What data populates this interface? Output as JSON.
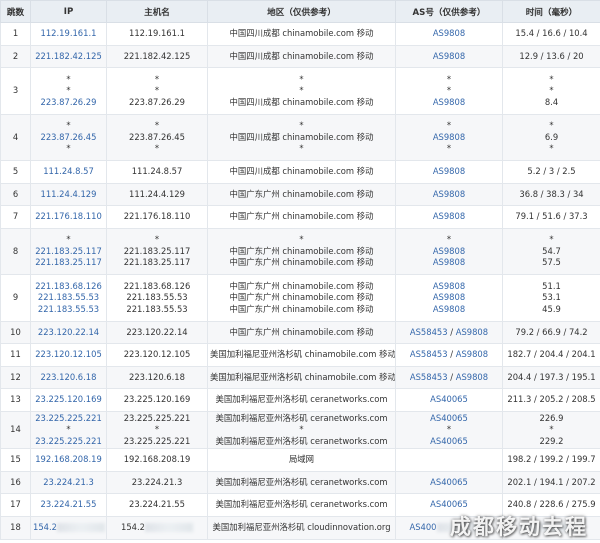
{
  "columns": [
    "跳数",
    "IP",
    "主机名",
    "地区（仅供参考）",
    "AS号（仅供参考）",
    "时间（毫秒）"
  ],
  "rows": [
    {
      "hop": "1",
      "lines": [
        {
          "ip": "112.19.161.1",
          "host": "112.19.161.1",
          "region": "中国四川成都 chinamobile.com 移动",
          "asn": [
            "AS9808"
          ],
          "time": "15.4 / 16.6 / 10.4"
        }
      ]
    },
    {
      "hop": "2",
      "lines": [
        {
          "ip": "221.182.42.125",
          "host": "221.182.42.125",
          "region": "中国四川成都 chinamobile.com 移动",
          "asn": [
            "AS9808"
          ],
          "time": "12.9 / 13.6 / 20"
        }
      ]
    },
    {
      "hop": "3",
      "lines": [
        {
          "ip": "*",
          "host": "*",
          "region": "*",
          "asn": [
            "*"
          ],
          "time": "*"
        },
        {
          "ip": "*",
          "host": "*",
          "region": "*",
          "asn": [
            "*"
          ],
          "time": "*"
        },
        {
          "ip": "223.87.26.29",
          "host": "223.87.26.29",
          "region": "中国四川成都 chinamobile.com 移动",
          "asn": [
            "AS9808"
          ],
          "time": "8.4"
        }
      ]
    },
    {
      "hop": "4",
      "lines": [
        {
          "ip": "*",
          "host": "*",
          "region": "*",
          "asn": [
            "*"
          ],
          "time": "*"
        },
        {
          "ip": "223.87.26.45",
          "host": "223.87.26.45",
          "region": "中国四川成都 chinamobile.com 移动",
          "asn": [
            "AS9808"
          ],
          "time": "6.9"
        },
        {
          "ip": "*",
          "host": "*",
          "region": "*",
          "asn": [
            "*"
          ],
          "time": "*"
        }
      ]
    },
    {
      "hop": "5",
      "lines": [
        {
          "ip": "111.24.8.57",
          "host": "111.24.8.57",
          "region": "中国四川成都 chinamobile.com 移动",
          "asn": [
            "AS9808"
          ],
          "time": "5.2 / 3 / 2.5"
        }
      ]
    },
    {
      "hop": "6",
      "lines": [
        {
          "ip": "111.24.4.129",
          "host": "111.24.4.129",
          "region": "中国广东广州 chinamobile.com 移动",
          "asn": [
            "AS9808"
          ],
          "time": "36.8 / 38.3 / 34"
        }
      ]
    },
    {
      "hop": "7",
      "lines": [
        {
          "ip": "221.176.18.110",
          "host": "221.176.18.110",
          "region": "中国广东广州 chinamobile.com 移动",
          "asn": [
            "AS9808"
          ],
          "time": "79.1 / 51.6 / 37.3"
        }
      ]
    },
    {
      "hop": "8",
      "lines": [
        {
          "ip": "*",
          "host": "*",
          "region": "*",
          "asn": [
            "*"
          ],
          "time": "*"
        },
        {
          "ip": "221.183.25.117",
          "host": "221.183.25.117",
          "region": "中国广东广州 chinamobile.com 移动",
          "asn": [
            "AS9808"
          ],
          "time": "54.7"
        },
        {
          "ip": "221.183.25.117",
          "host": "221.183.25.117",
          "region": "中国广东广州 chinamobile.com 移动",
          "asn": [
            "AS9808"
          ],
          "time": "57.5"
        }
      ]
    },
    {
      "hop": "9",
      "lines": [
        {
          "ip": "221.183.68.126",
          "host": "221.183.68.126",
          "region": "中国广东广州 chinamobile.com 移动",
          "asn": [
            "AS9808"
          ],
          "time": "51.1"
        },
        {
          "ip": "221.183.55.53",
          "host": "221.183.55.53",
          "region": "中国广东广州 chinamobile.com 移动",
          "asn": [
            "AS9808"
          ],
          "time": "53.1"
        },
        {
          "ip": "221.183.55.53",
          "host": "221.183.55.53",
          "region": "中国广东广州 chinamobile.com 移动",
          "asn": [
            "AS9808"
          ],
          "time": "45.9"
        }
      ]
    },
    {
      "hop": "10",
      "lines": [
        {
          "ip": "223.120.22.14",
          "host": "223.120.22.14",
          "region": "中国广东广州 chinamobile.com 移动",
          "asn": [
            "AS58453",
            "AS9808"
          ],
          "time": "79.2 / 66.9 / 74.2"
        }
      ]
    },
    {
      "hop": "11",
      "lines": [
        {
          "ip": "223.120.12.105",
          "host": "223.120.12.105",
          "region": "美国加利福尼亚州洛杉矶 chinamobile.com 移动",
          "asn": [
            "AS58453",
            "AS9808"
          ],
          "time": "182.7 / 204.4 / 204.1"
        }
      ]
    },
    {
      "hop": "12",
      "lines": [
        {
          "ip": "223.120.6.18",
          "host": "223.120.6.18",
          "region": "美国加利福尼亚州洛杉矶 chinamobile.com 移动",
          "asn": [
            "AS58453",
            "AS9808"
          ],
          "time": "204.4 / 197.3 / 195.1"
        }
      ]
    },
    {
      "hop": "13",
      "lines": [
        {
          "ip": "23.225.120.169",
          "host": "23.225.120.169",
          "region": "美国加利福尼亚州洛杉矶 ceranetworks.com",
          "asn": [
            "AS40065"
          ],
          "time": "211.3 / 205.2 / 208.5"
        }
      ]
    },
    {
      "hop": "14",
      "lines": [
        {
          "ip": "23.225.225.221",
          "host": "23.225.225.221",
          "region": "美国加利福尼亚州洛杉矶 ceranetworks.com",
          "asn": [
            "AS40065"
          ],
          "time": "226.9"
        },
        {
          "ip": "*",
          "host": "*",
          "region": "*",
          "asn": [
            "*"
          ],
          "time": "*"
        },
        {
          "ip": "23.225.225.221",
          "host": "23.225.225.221",
          "region": "美国加利福尼亚州洛杉矶 ceranetworks.com",
          "asn": [
            "AS40065"
          ],
          "time": "229.2"
        }
      ]
    },
    {
      "hop": "15",
      "lines": [
        {
          "ip": "192.168.208.19",
          "host": "192.168.208.19",
          "region": "局域网",
          "asn": [
            ""
          ],
          "time": "198.2 / 199.2 / 199.7"
        }
      ]
    },
    {
      "hop": "16",
      "lines": [
        {
          "ip": "23.224.21.3",
          "host": "23.224.21.3",
          "region": "美国加利福尼亚州洛杉矶 ceranetworks.com",
          "asn": [
            "AS40065"
          ],
          "time": "202.1 / 194.1 / 207.2"
        }
      ]
    },
    {
      "hop": "17",
      "lines": [
        {
          "ip": "23.224.21.55",
          "host": "23.224.21.55",
          "region": "美国加利福尼亚州洛杉矶 ceranetworks.com",
          "asn": [
            "AS40065"
          ],
          "time": "240.8 / 228.6 / 275.9"
        }
      ]
    },
    {
      "hop": "18",
      "lines": [
        {
          "ip": "154.2",
          "host": "154.2",
          "region": "美国加利福尼亚州洛杉矶 cloudinnovation.org",
          "asn": [
            "AS400"
          ],
          "time": "2",
          "redacted": true
        }
      ]
    }
  ],
  "watermark": "成都移动去程"
}
